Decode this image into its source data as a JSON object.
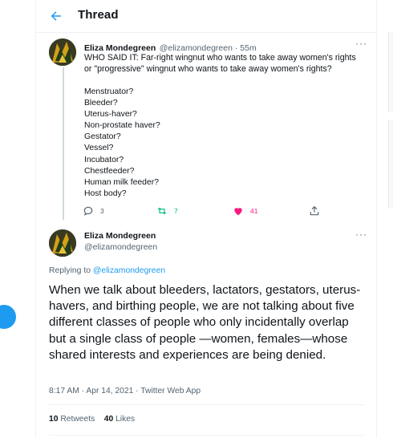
{
  "header": {
    "title": "Thread",
    "back_icon": "arrow-left-icon"
  },
  "tweet1": {
    "name": "Eliza Mondegreen",
    "handle": "@elizamondegreen",
    "time": "55m",
    "text": "WHO SAID IT: Far-right wingnut who wants to take away women's rights or \"progressive\" wingnut who wants to take away women's rights?",
    "list": [
      "Menstruator?",
      "Bleeder?",
      "Uterus-haver?",
      "Non-prostate haver?",
      "Gestator?",
      "Vessel?",
      "Incubator?",
      "Chestfeeder?",
      "Human milk feeder?",
      "Host body?"
    ],
    "actions": {
      "replies": "3",
      "retweets": "7",
      "likes": "41"
    }
  },
  "tweet2": {
    "name": "Eliza Mondegreen",
    "handle": "@elizamondegreen",
    "replying_prefix": "Replying to",
    "replying_to": "@elizamondegreen",
    "text": "When we talk about bleeders, lactators, gestators, uterus-havers, and birthing people, we are not talking about five different classes of people who only incidentally overlap but a single class of people —women, females—whose shared interests and experiences are being denied.",
    "timestamp": "8:17 AM · Apr 14, 2021 · Twitter Web App",
    "retweets_count": "10",
    "retweets_label": "Retweets",
    "likes_count": "40",
    "likes_label": "Likes"
  },
  "colors": {
    "accent": "#1d9bf0",
    "retweet": "#00ba7c",
    "like": "#f91880",
    "secondary": "#536471"
  }
}
